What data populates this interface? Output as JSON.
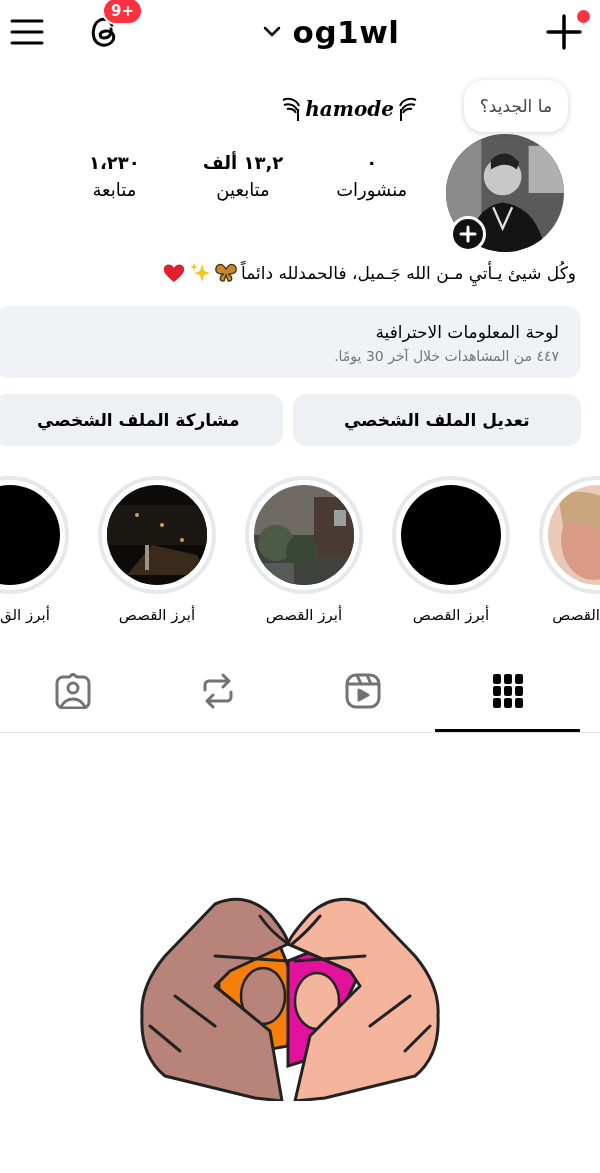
{
  "top_bar": {
    "notifications_badge": "9+",
    "username": "og1wl",
    "create_has_dot": true
  },
  "profile": {
    "tooltip": "ما الجديد؟",
    "name": "hamode",
    "bio": "وكُل شيئ يـأتيِ مـن الله جَـميل، فالحمدلله دائماً",
    "stats": [
      {
        "value": "٠",
        "label": "منشورات"
      },
      {
        "value": "١٣,٢ ألف",
        "label": "متابعين"
      },
      {
        "value": "١،٢٣٠",
        "label": "متابعة"
      }
    ]
  },
  "dashboard": {
    "title": "لوحة المعلومات الاحترافية",
    "subtitle": "٤٤٧ من المشاهدات خلال آخر 30 يومًا."
  },
  "buttons": [
    "تعديل الملف الشخصي",
    "مشاركة الملف الشخصي"
  ],
  "highlights": [
    {
      "kind": "picture",
      "label": "القصص"
    },
    {
      "kind": "blank",
      "label": "أبرز القصص"
    },
    {
      "kind": "picture",
      "label": "أبرز القصص"
    },
    {
      "kind": "picture",
      "label": "أبرز القصص"
    },
    {
      "kind": "blank",
      "label": "أبرز الق"
    }
  ],
  "tabs": [
    {
      "kind": "grid",
      "selected": true
    },
    {
      "kind": "reels",
      "selected": false
    },
    {
      "kind": "reposts",
      "selected": false
    },
    {
      "kind": "tagged",
      "selected": false
    }
  ]
}
